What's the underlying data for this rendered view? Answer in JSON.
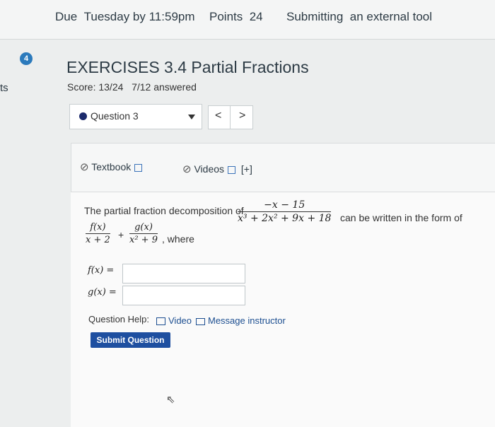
{
  "header": {
    "due_label": "Due",
    "due_value": "Tuesday by 11:59pm",
    "points_label": "Points",
    "points_value": "24",
    "submitting_label": "Submitting",
    "submitting_value": "an external tool"
  },
  "sidebar_fragment": "ts",
  "badge": "4",
  "assignment": {
    "title": "EXERCISES 3.4 Partial Fractions",
    "score": "Score: 13/24",
    "answered": "7/12 answered"
  },
  "question_select": {
    "selected": "Question 3"
  },
  "nav": {
    "prev": "<",
    "next": ">"
  },
  "resources": {
    "textbook": "Textbook",
    "videos": "Videos",
    "expand": "[+]"
  },
  "problem": {
    "intro": "The partial fraction decomposition of",
    "main_num": "−x − 15",
    "main_den": "x³ + 2x² + 9x + 18",
    "middle": "can be written in the form of",
    "f_num": "f(x)",
    "f_den": "x + 2",
    "plus": "+",
    "g_num": "g(x)",
    "g_den": "x² + 9",
    "where": ", where",
    "f_label": "f(x) =",
    "g_label": "g(x) ="
  },
  "answers": {
    "f_value": "",
    "g_value": ""
  },
  "help": {
    "label": "Question Help:",
    "video": "Video",
    "message": "Message instructor"
  },
  "submit_label": "Submit Question"
}
